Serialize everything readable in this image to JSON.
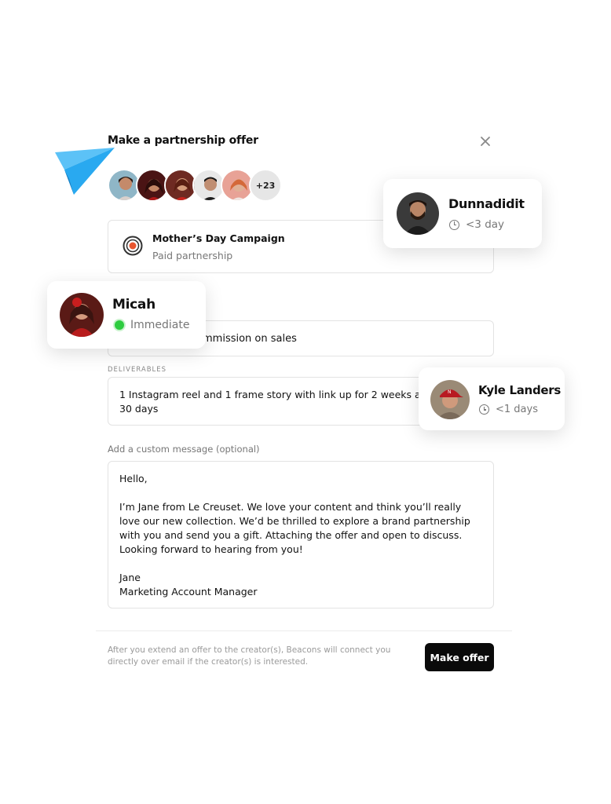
{
  "modal": {
    "title": "Make a partnership offer",
    "more_creators": "+23",
    "campaign": {
      "name": "Mother’s Day Campaign",
      "type": "Paid partnership"
    },
    "compensation_value": "mmission on sales",
    "deliverables_label": "DELIVERABLES",
    "deliverables_value": "1 Instagram reel and 1 frame story with link up for 2 weeks and us\n30 days",
    "message_label": "Add a custom message (optional)",
    "message_value": "Hello,\n\nI’m Jane from Le Creuset. We love your content and think you’ll really love our new collection. We’d be thrilled to explore a brand partnership with you and send you a gift. Attaching the offer and open to discuss. Looking forward to hearing from you!\n\nJane\nMarketing Account Manager",
    "footer_note": "After you extend an offer to the creator(s), Beacons will connect you directly over email if the creator(s) is interested.",
    "make_offer_label": "Make offer"
  },
  "creators": [
    {
      "name": "Dunnadidit",
      "status": "<3 day",
      "status_icon": "clock-icon"
    },
    {
      "name": "Micah",
      "status": "Immediate",
      "status_icon": "online-dot"
    },
    {
      "name": "Kyle Landers",
      "status": "<1 days",
      "status_icon": "clock-icon"
    }
  ],
  "colors": {
    "accent": "#0a0a0a",
    "plane": "#29a9f0",
    "online": "#2ecc40"
  },
  "icons": [
    "close-icon",
    "paper-plane-icon",
    "campaign-icon",
    "clock-icon"
  ]
}
